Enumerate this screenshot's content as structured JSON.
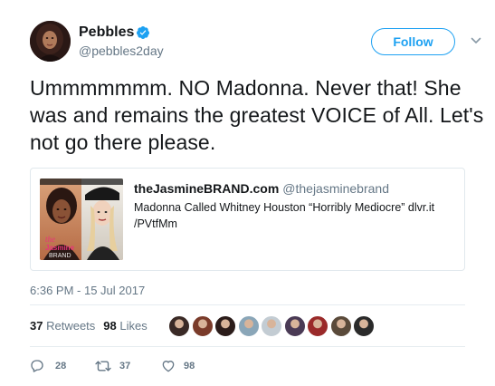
{
  "user": {
    "display_name": "Pebbles",
    "handle": "@pebbles2day",
    "verified": true
  },
  "follow_label": "Follow",
  "tweet": {
    "text": "Ummmmmmm. NO Madonna. Never that! She was and remains the greatest VOICE of All. Let's not go there please."
  },
  "quote": {
    "author_name": "theJasmineBRAND.com",
    "author_handle": "@thejasminebrand",
    "text": "Madonna Called Whitney Houston “Horribly Mediocre”  dlvr.it /PVtfMm",
    "image_watermark": "the Jasmine BRAND"
  },
  "timestamp": "6:36 PM - 15 Jul 2017",
  "stats": {
    "retweets_count": "37",
    "retweets_label": "Retweets",
    "likes_count": "98",
    "likes_label": "Likes"
  },
  "likers": [
    {
      "color": "#3a2a26"
    },
    {
      "color": "#7a3b2a"
    },
    {
      "color": "#2b1c1a"
    },
    {
      "color": "#8aa6b8"
    },
    {
      "color": "#c3ccd3"
    },
    {
      "color": "#4a3a55"
    },
    {
      "color": "#9a2a2a"
    },
    {
      "color": "#5a4a3a"
    },
    {
      "color": "#2a2a2a"
    }
  ],
  "actions": {
    "reply_count": "28",
    "retweet_count": "37",
    "like_count": "98"
  },
  "colors": {
    "accent": "#1da1f2",
    "text": "#14171a",
    "muted": "#657786",
    "border": "#e1e8ed"
  },
  "icons": {
    "verified": "verified-badge-icon",
    "chevron": "chevron-down-icon",
    "reply": "reply-icon",
    "retweet": "retweet-icon",
    "like": "heart-icon"
  }
}
